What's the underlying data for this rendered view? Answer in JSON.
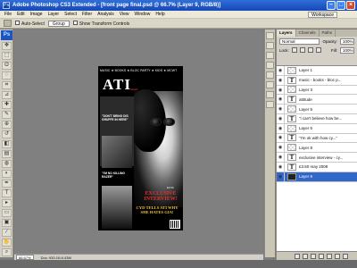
{
  "window": {
    "title": "Adobe Photoshop CS3 Extended - [front page final.psd @ 66.7% (Layer 9, RGB/8)]",
    "app_icon": "Ps"
  },
  "menu": [
    "File",
    "Edit",
    "Image",
    "Layer",
    "Select",
    "Filter",
    "Analysis",
    "View",
    "Window",
    "Help"
  ],
  "workspace_label": "Workspace",
  "options_bar": {
    "auto_select_label": "Auto-Select",
    "auto_select_value": "Group",
    "transform_label": "Show Transform Controls"
  },
  "toolbox": {
    "logo": "Ps",
    "tools": [
      "move-tool",
      "marquee-tool",
      "lasso-tool",
      "quick-select-tool",
      "crop-tool",
      "slice-tool",
      "healing-tool",
      "brush-tool",
      "stamp-tool",
      "history-brush-tool",
      "eraser-tool",
      "gradient-tool",
      "blur-tool",
      "dodge-tool",
      "pen-tool",
      "type-tool",
      "path-select-tool",
      "shape-tool",
      "notes-tool",
      "eyedropper-tool",
      "hand-tool",
      "zoom-tool"
    ],
    "tool_glyphs": [
      "✥",
      "⬚",
      "ʘ",
      "◌",
      "⌗",
      "⊿",
      "✚",
      "✎",
      "⊕",
      "↺",
      "◧",
      "▤",
      "◍",
      "◐",
      "✒",
      "T",
      "▸",
      "▭",
      "▣",
      "⁄",
      "✋",
      "⌕"
    ]
  },
  "magazine": {
    "strapline": "MUSIC ★ BOOKS ★ BLOC PARTY ★ KIDS ★ MCWT",
    "logo": "ATI",
    "logo_sub": "music",
    "quote1": "\"DON'T BRING DIS GRUFFE IN HERE\"",
    "quote2": "\"I'M NO KILLING RAZER\"",
    "exclusive": "EXCLUSIVE INTERVIEW!",
    "cover_line": "CYD TELLS ATI WHY SHE HATES GIA!",
    "price": "£3.50"
  },
  "status": {
    "zoom": "66.67%",
    "doc_info": "Doc: 933.1K/4.43M"
  },
  "layers_panel": {
    "tabs": [
      "Layers",
      "Channels",
      "Paths"
    ],
    "active_tab": "Layers",
    "blend_mode": "Normal",
    "opacity_label": "Opacity:",
    "opacity": "100%",
    "lock_label": "Lock:",
    "fill_label": "Fill:",
    "fill": "100%",
    "layers": [
      {
        "name": "Layer 1",
        "type": "raster",
        "selected": false
      },
      {
        "name": "music - books - bloc p...",
        "type": "text",
        "selected": false
      },
      {
        "name": "Layer 3",
        "type": "raster",
        "selected": false
      },
      {
        "name": "attitude",
        "type": "text",
        "selected": false
      },
      {
        "name": "Layer 5",
        "type": "raster",
        "selected": false
      },
      {
        "name": "\"i can't believe how be...",
        "type": "text",
        "selected": false
      },
      {
        "name": "Layer 6",
        "type": "raster",
        "selected": false
      },
      {
        "name": "\"I'm ok with how cy...\"",
        "type": "text",
        "selected": false
      },
      {
        "name": "Layer 8",
        "type": "raster",
        "selected": false
      },
      {
        "name": "exclusive interview - cy...",
        "type": "text",
        "selected": false
      },
      {
        "name": "£3.50 may 2008",
        "type": "text",
        "selected": false
      },
      {
        "name": "Layer 9",
        "type": "image",
        "selected": true
      }
    ]
  }
}
